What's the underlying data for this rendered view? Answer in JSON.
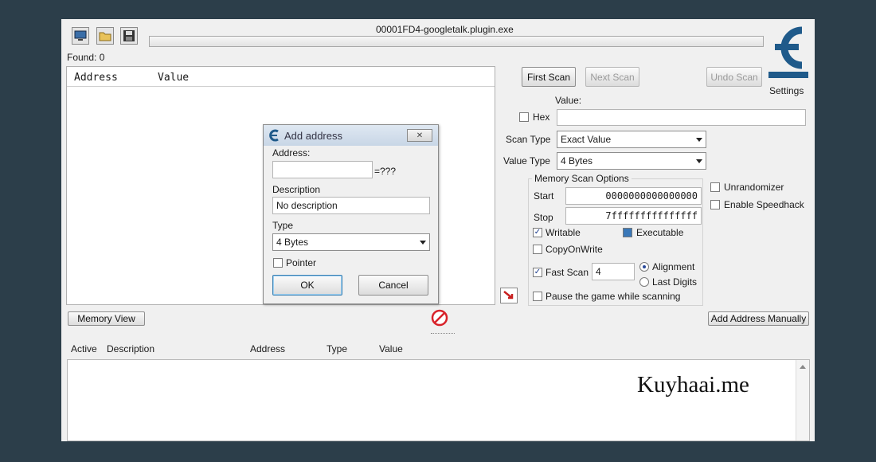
{
  "window": {
    "title": "00001FD4-googletalk.plugin.exe"
  },
  "toolbar": {
    "open_process_icon": "computer-icon",
    "open_file_icon": "folder-icon",
    "save_icon": "save-icon"
  },
  "found": "Found: 0",
  "results": {
    "columns": [
      "Address",
      "Value"
    ]
  },
  "scan": {
    "first_scan": "First Scan",
    "next_scan": "Next Scan",
    "undo_scan": "Undo Scan",
    "settings": "Settings",
    "value_label": "Value:",
    "hex_label": "Hex",
    "scan_type_label": "Scan Type",
    "scan_type_value": "Exact Value",
    "value_type_label": "Value Type",
    "value_type_value": "4 Bytes",
    "memory_options_label": "Memory Scan Options",
    "start_label": "Start",
    "start_value": "0000000000000000",
    "stop_label": "Stop",
    "stop_value": "7fffffffffffffff",
    "writable": "Writable",
    "executable": "Executable",
    "copy_on_write": "CopyOnWrite",
    "fast_scan": "Fast Scan",
    "fast_scan_value": "4",
    "alignment": "Alignment",
    "last_digits": "Last Digits",
    "pause_game": "Pause the game while scanning",
    "unrandomizer": "Unrandomizer",
    "speedhack": "Enable Speedhack"
  },
  "dialog": {
    "title": "Add address",
    "address_label": "Address:",
    "address_suffix": "=???",
    "description_label": "Description",
    "description_value": "No description",
    "type_label": "Type",
    "type_value": "4 Bytes",
    "pointer_label": "Pointer",
    "ok": "OK",
    "cancel": "Cancel",
    "close_glyph": "✕"
  },
  "bottom": {
    "memory_view": "Memory View",
    "add_manually": "Add Address Manually",
    "columns": [
      "Active",
      "Description",
      "Address",
      "Type",
      "Value"
    ]
  },
  "watermark": "Kuyhaai.me",
  "colors": {
    "background": "#2c3e4a",
    "window": "#f0f0f0",
    "logo": "#1f5a8a",
    "stop_red": "#d8222a"
  }
}
